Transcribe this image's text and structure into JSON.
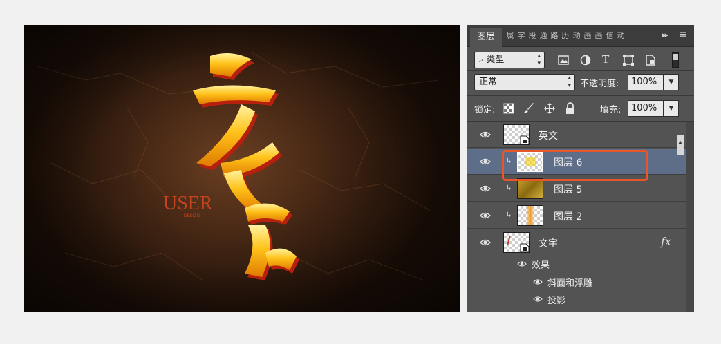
{
  "artwork": {
    "main_calligraphy": "六能站",
    "sub_text": "USER",
    "sub_caption": "DESIGN"
  },
  "panel": {
    "tab_active": "图层",
    "tab_icons": [
      "属",
      "字",
      "段",
      "通",
      "路",
      "历",
      "动",
      "画",
      "画",
      "信",
      "动"
    ],
    "more": "▸▸",
    "menu": "≡",
    "filter": {
      "label": "类型",
      "icons": [
        "image-filter-icon",
        "adjustment-filter-icon",
        "type-filter-icon",
        "shape-filter-icon",
        "smart-object-filter-icon"
      ]
    },
    "blend_mode": "正常",
    "opacity_label": "不透明度:",
    "opacity_value": "100%",
    "lock_label": "锁定:",
    "fill_label": "填充:",
    "fill_value": "100%",
    "layers": [
      {
        "name": "英文",
        "selected": false,
        "clipped": false
      },
      {
        "name": "图层 6",
        "selected": true,
        "clipped": true
      },
      {
        "name": "图层 5",
        "selected": false,
        "clipped": true
      },
      {
        "name": "图层 2",
        "selected": false,
        "clipped": true
      },
      {
        "name": "文字",
        "selected": false,
        "clipped": false,
        "fx": "fx"
      }
    ],
    "effects_label": "效果",
    "effects": [
      "斜面和浮雕",
      "投影"
    ]
  },
  "colors": {
    "highlight": "#e8562a",
    "selected_row": "#5f6e88",
    "panel_bg": "#535353"
  }
}
